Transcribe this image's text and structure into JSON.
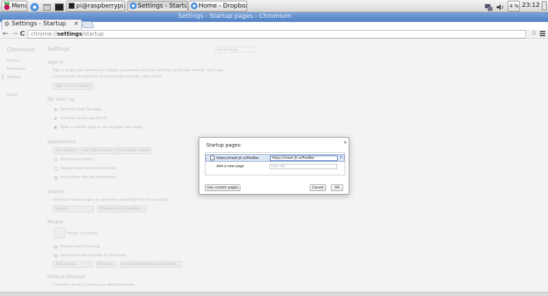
{
  "taskbar": {
    "menu_label": "Menu",
    "terminal_label": "pi@raspberrypi: ~",
    "window1_label": "Settings - Startup p...",
    "window2_label": "Home - Dropbox - C...",
    "battery": "4 %",
    "clock": "23:12"
  },
  "window": {
    "title": "Settings - Startup pages - Chromium"
  },
  "tab": {
    "label": "Settings - Startup",
    "close": "×"
  },
  "toolbar": {
    "back": "←",
    "forward": "→",
    "reload": "C",
    "url_prefix": "chrome://",
    "url_bold": "settings",
    "url_suffix": "/startup",
    "star": "☆"
  },
  "settings": {
    "sidebar": {
      "brand": "Chromium",
      "history": "History",
      "extensions": "Extensions",
      "settings": "Settings",
      "about": "About"
    },
    "title": "Settings",
    "search_placeholder": "Search settings",
    "signin": {
      "heading": "Sign in",
      "line1": "Sign in to get your bookmarks, history, passwords and other settings on all your devices. You'll also",
      "line2": "automatically be signed in to your Google services.",
      "learn_more": "Learn more",
      "button": "Sign in to Chromium"
    },
    "startup": {
      "heading": "On start up",
      "opt1": "Open the New Tab page",
      "opt2": "Continue where you left off",
      "opt3": "Open a specific page or set of pages.",
      "set_pages": "Set pages"
    },
    "appearance": {
      "heading": "Appearance",
      "get_themes": "Get themes",
      "use_gtk": "Use GTK+ theme",
      "use_classic": "Use Classic theme",
      "show_home": "Show Home button",
      "always_bookmarks": "Always show the bookmarks bar",
      "use_system_title": "Use system title bar and borders"
    },
    "search": {
      "heading": "Search",
      "line": "Set which search engine is used when searching from the",
      "omnibox": "omnibox.",
      "engine": "Google",
      "manage": "Manage search engines..."
    },
    "people": {
      "heading": "People",
      "person": "Person 1 (current)",
      "guest": "Enable Guest browsing",
      "anyone": "Let anyone add a person to Chromium",
      "add": "Add person...",
      "remove": "Remove...",
      "import": "Import bookmarks and settings..."
    },
    "default_browser": {
      "heading": "Default browser",
      "line": "Chromium is not currently your default browser."
    }
  },
  "dialog": {
    "title": "Startup pages:",
    "close": "×",
    "row1_url": "https://meet.jit.si/FooBar",
    "row1_edit": "https://meet.jit.si/FooBar",
    "row1_remove": "×",
    "add_label": "Add a new page",
    "add_placeholder": "Enter URL...",
    "use_current": "Use current pages",
    "cancel": "Cancel",
    "ok": "OK"
  },
  "colors": {
    "titlebar": "#4f7fc4",
    "selection": "#dde6f5",
    "input_focus": "#4d78c4"
  }
}
